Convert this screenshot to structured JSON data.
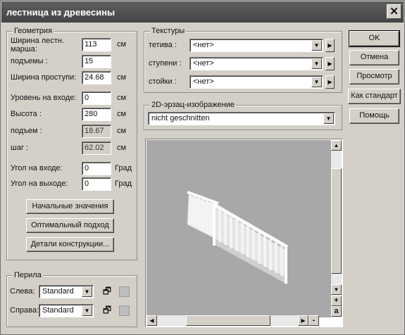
{
  "window": {
    "title": "лестница из древесины",
    "close_glyph": "✕"
  },
  "geometry": {
    "legend": "Геометрия",
    "fields": [
      {
        "label": "Ширина лестн. марша:",
        "value": "113",
        "unit": "см"
      },
      {
        "label": "подъемы :",
        "value": "15",
        "unit": ""
      },
      {
        "label": "Ширина проступи:",
        "value": "24.68",
        "unit": "см"
      },
      {
        "label": "Уровень на входе:",
        "value": "0",
        "unit": "см"
      },
      {
        "label": "Высота :",
        "value": "280",
        "unit": "см"
      },
      {
        "label": "подъем :",
        "value": "18.67",
        "unit": "см"
      },
      {
        "label": "шаг :",
        "value": "62.02",
        "unit": "см"
      },
      {
        "label": "Угол на входе:",
        "value": "0",
        "unit": "Град"
      },
      {
        "label": "Угол на выходе:",
        "value": "0",
        "unit": "Град"
      }
    ],
    "buttons": {
      "defaults": "Начальные значения",
      "optimal": "Оптимальный подход",
      "details": "Детали конструкции..."
    }
  },
  "railing": {
    "legend": "Перила",
    "left_label": "Слева:",
    "left_value": "Standard",
    "right_label": "Справа:",
    "right_value": "Standard"
  },
  "textures": {
    "legend": "Текстуры",
    "rows": [
      {
        "label": "тетива :",
        "value": "<нет>"
      },
      {
        "label": "ступени :",
        "value": "<нет>"
      },
      {
        "label": "стойки :",
        "value": "<нет>"
      }
    ]
  },
  "preview2d": {
    "legend": "2D-эрзац-изображение",
    "value": "nicht geschnitten"
  },
  "actions": {
    "ok": "OK",
    "cancel": "Отмена",
    "preview": "Просмотр",
    "as_standard": "Как стандарт",
    "help": "Помощь"
  },
  "viewport": {
    "zoom_in_glyph": "+",
    "zoom_out_glyph": "-",
    "fit_glyph": "a"
  },
  "icons": {
    "dropdown": "triangle-down-icon",
    "next": "triangle-right-icon",
    "properties": "properties-icon"
  },
  "colors": {
    "titlebar": "#4a4a4a",
    "dialog": "#d4d0c8",
    "viewport_bg": "#a8a8a8"
  }
}
